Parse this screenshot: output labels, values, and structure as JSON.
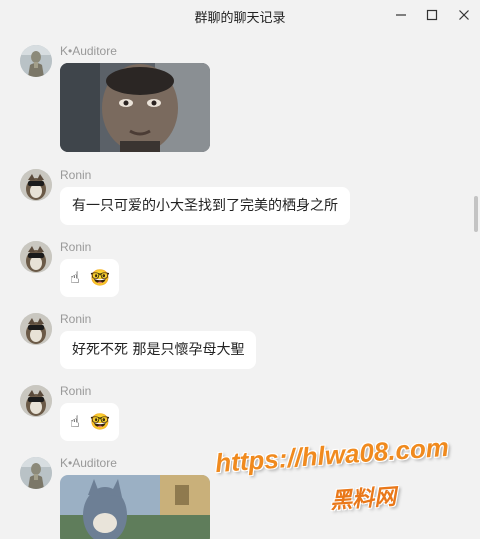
{
  "window": {
    "title": "群聊的聊天记录",
    "minimize_icon": "minimize-icon",
    "maximize_icon": "maximize-icon",
    "close_icon": "close-icon"
  },
  "messages": [
    {
      "sender": "K•Auditore",
      "type": "image",
      "avatar": "statue-avatar"
    },
    {
      "sender": "Ronin",
      "type": "text",
      "text": "有一只可爱的小大圣找到了完美的栖身之所",
      "avatar": "dog-avatar"
    },
    {
      "sender": "Ronin",
      "type": "emoji",
      "emoji": [
        "☝",
        "🤓"
      ],
      "avatar": "dog-avatar"
    },
    {
      "sender": "Ronin",
      "type": "text",
      "text": "好死不死 那是只懷孕母大聖",
      "avatar": "dog-avatar"
    },
    {
      "sender": "Ronin",
      "type": "emoji",
      "emoji": [
        "☝",
        "🤓"
      ],
      "avatar": "dog-avatar"
    },
    {
      "sender": "K•Auditore",
      "type": "image",
      "avatar": "statue-avatar"
    }
  ],
  "watermark": {
    "url": "https://hlwa08.com",
    "name": "黑料网"
  },
  "colors": {
    "background": "#f2f2f2",
    "bubble": "#ffffff",
    "sender_name": "#999999",
    "watermark": "#f08a1e"
  }
}
